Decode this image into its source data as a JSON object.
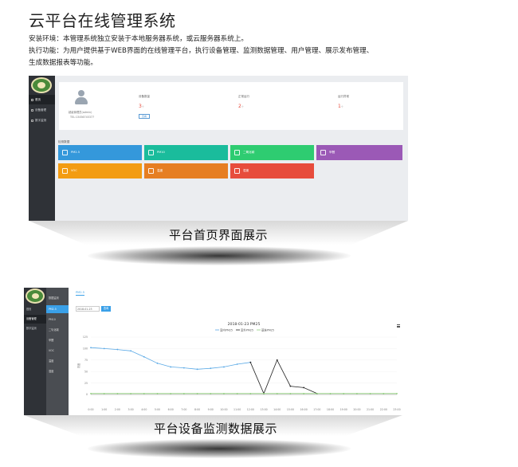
{
  "page": {
    "title": "云平台在线管理系统",
    "intro_lines": [
      "安装环境：本管理系统独立安装于本地服务器系统，或云服务器系统上。",
      "执行功能：为用户提供基于WEB界面的在线管理平台，执行设备管理、监测数据管理、用户管理、展示发布管理、",
      "生成数据报表等功能。"
    ]
  },
  "dashboard": {
    "caption": "平台首页界面展示",
    "nav": [
      "首页",
      "设备管理",
      "数字监测"
    ],
    "user": {
      "name": "超级管理员(admin)",
      "tel": "TEL:13456745377"
    },
    "stats": [
      {
        "label": "设备数量",
        "value": "3",
        "unit": "个"
      },
      {
        "label": "正常运行",
        "value": "2",
        "unit": "个"
      },
      {
        "label": "运行异常",
        "value": "1",
        "unit": "个"
      }
    ],
    "detail_button": "查看",
    "section_title": "检测数据",
    "tiles": [
      {
        "label": "PM2.5",
        "color": "#3498db"
      },
      {
        "label": "PM10",
        "color": "#1abc9c"
      },
      {
        "label": "二氧化碳",
        "color": "#2ecc71"
      },
      {
        "label": "甲醛",
        "color": "#9b59b6"
      },
      {
        "label": "VOC",
        "color": "#f39c12"
      },
      {
        "label": "温度",
        "color": "#e67e22"
      },
      {
        "label": "湿度",
        "color": "#e74c3c"
      }
    ]
  },
  "monitor": {
    "caption": "平台设备监测数据展示",
    "nav": [
      "首页",
      "设备管理",
      "数字监测"
    ],
    "submenu_title": "数据监测",
    "submenu": [
      "PM2.5",
      "PM10",
      "二氧化碳",
      "甲醛",
      "VOC",
      "温度",
      "湿度"
    ],
    "tab": "PM2.5",
    "date_value": "2018-01-23",
    "query_button": "查询",
    "chart_data": {
      "type": "line",
      "title": "2018-01-23 PM25",
      "ylabel": "浓度",
      "ylim": [
        0,
        125
      ],
      "yticks": [
        "0",
        "25",
        "50",
        "75",
        "100",
        "125"
      ],
      "x": [
        "0:00",
        "1:00",
        "2:00",
        "3:00",
        "4:00",
        "5:00",
        "6:00",
        "7:00",
        "8:00",
        "9:00",
        "10:00",
        "11:00",
        "12:00",
        "13:00",
        "14:00",
        "15:00",
        "16:00",
        "17:00",
        "18:00",
        "19:00",
        "20:00",
        "21:00",
        "22:00",
        "23:00"
      ],
      "series": [
        {
          "name": "室内PM25",
          "color": "#5aa9e6",
          "values": [
            102,
            100,
            98,
            95,
            82,
            68,
            60,
            58,
            55,
            57,
            60,
            66,
            70,
            null,
            null,
            null,
            null,
            null,
            null,
            null,
            null,
            null,
            null,
            null
          ]
        },
        {
          "name": "室外PM25",
          "color": "#222222",
          "values": [
            null,
            null,
            null,
            null,
            null,
            null,
            null,
            null,
            null,
            null,
            null,
            null,
            70,
            2,
            75,
            18,
            15,
            2,
            null,
            null,
            null,
            null,
            null,
            null
          ]
        },
        {
          "name": "基准PM25",
          "color": "#8ed07a",
          "values": [
            2,
            2,
            2,
            2,
            2,
            2,
            2,
            2,
            2,
            2,
            2,
            2,
            2,
            2,
            2,
            2,
            2,
            2,
            2,
            2,
            2,
            2,
            2,
            2
          ]
        }
      ],
      "legend": "top-center"
    }
  }
}
